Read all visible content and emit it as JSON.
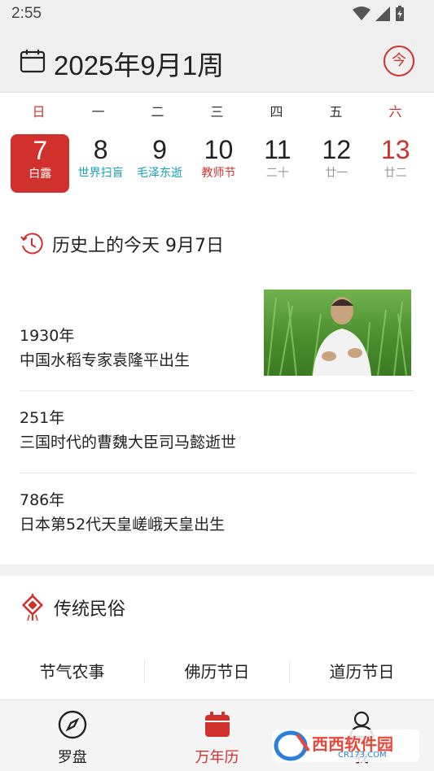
{
  "status": {
    "time": "2:55"
  },
  "header": {
    "title": "2025年9月1周",
    "today_label": "今"
  },
  "weekdays": [
    "日",
    "一",
    "二",
    "三",
    "四",
    "五",
    "六"
  ],
  "days": [
    {
      "num": "7",
      "sub": "白露"
    },
    {
      "num": "8",
      "sub": "世界扫盲"
    },
    {
      "num": "9",
      "sub": "毛泽东逝"
    },
    {
      "num": "10",
      "sub": "教师节"
    },
    {
      "num": "11",
      "sub": "二十"
    },
    {
      "num": "12",
      "sub": "廿一"
    },
    {
      "num": "13",
      "sub": "廿二"
    }
  ],
  "history": {
    "title": "历史上的今天 9月7日",
    "items": [
      {
        "year": "1930年",
        "desc": "中国水稻专家袁隆平出生"
      },
      {
        "year": "251年",
        "desc": "三国时代的曹魏大臣司马懿逝世"
      },
      {
        "year": "786年",
        "desc": "日本第52代天皇嵯峨天皇出生"
      }
    ]
  },
  "folk": {
    "title": "传统民俗",
    "tabs": [
      "节气农事",
      "佛历节日",
      "道历节日"
    ]
  },
  "nav": {
    "items": [
      {
        "label": "罗盘"
      },
      {
        "label": "万年历"
      },
      {
        "label": "我"
      }
    ]
  },
  "watermark": {
    "text": "西西软件园",
    "url_text": "CR173.COM"
  },
  "colors": {
    "accent": "#d0312d",
    "cyan": "#17a2b8"
  }
}
